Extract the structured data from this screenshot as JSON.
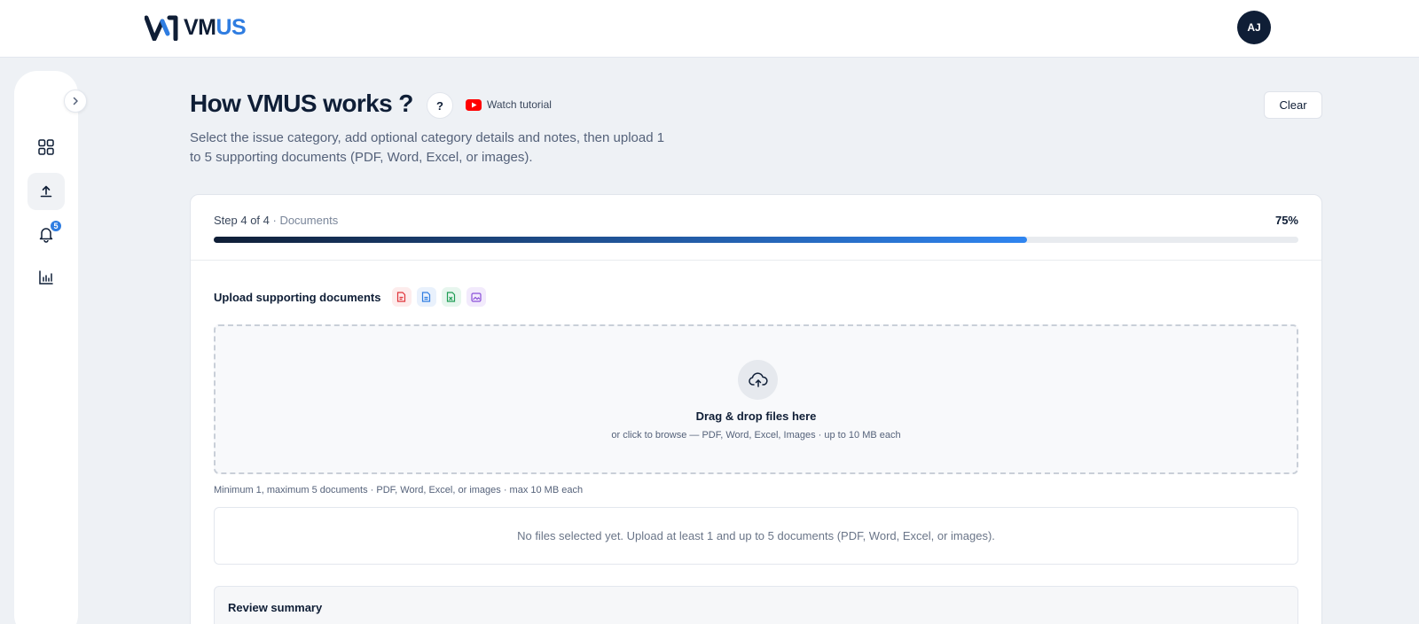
{
  "header": {
    "logo_text_a": "VM",
    "logo_text_b": "US",
    "avatar_initials": "AJ"
  },
  "sidebar": {
    "items": [
      {
        "name": "dashboard",
        "icon": "grid-icon",
        "active": false
      },
      {
        "name": "upload",
        "icon": "upload-icon",
        "active": true
      },
      {
        "name": "notifications",
        "icon": "bell-icon",
        "active": false,
        "badge": "5"
      },
      {
        "name": "analytics",
        "icon": "chart-icon",
        "active": false
      }
    ]
  },
  "page": {
    "title": "How VMUS works ?",
    "help_label": "?",
    "tutorial_label": "Watch tutorial",
    "description": "Select the issue category, add optional category details and notes, then upload 1 to 5 supporting documents (PDF, Word, Excel, or images).",
    "clear_label": "Clear"
  },
  "progress": {
    "step_text": "Step 4 of 4",
    "step_sub": " · Documents",
    "percent_label": "75%",
    "percent_value": 75
  },
  "upload": {
    "title": "Upload supporting documents",
    "file_types": [
      {
        "name": "pdf-file-icon",
        "color": "#e0343a",
        "bg": "#fdecec"
      },
      {
        "name": "word-file-icon",
        "color": "#2f7de1",
        "bg": "#e9f1fc"
      },
      {
        "name": "excel-file-icon",
        "color": "#1f9d55",
        "bg": "#e7f6ee"
      },
      {
        "name": "image-file-icon",
        "color": "#8a4fd8",
        "bg": "#f2eafc"
      }
    ],
    "drop_title": "Drag & drop files here",
    "drop_sub": "or click to browse — PDF, Word, Excel, Images · up to 10 MB each",
    "limits_note": "Minimum 1, maximum 5 documents · PDF, Word, Excel, or images · max 10 MB each",
    "empty_text": "No files selected yet. Upload at least 1 and up to 5 documents (PDF, Word, Excel, or images)."
  },
  "review": {
    "title": "Review summary"
  },
  "colors": {
    "brand_dark": "#0f1e36",
    "brand_blue": "#2f7de1",
    "youtube_red": "#ff0000"
  }
}
